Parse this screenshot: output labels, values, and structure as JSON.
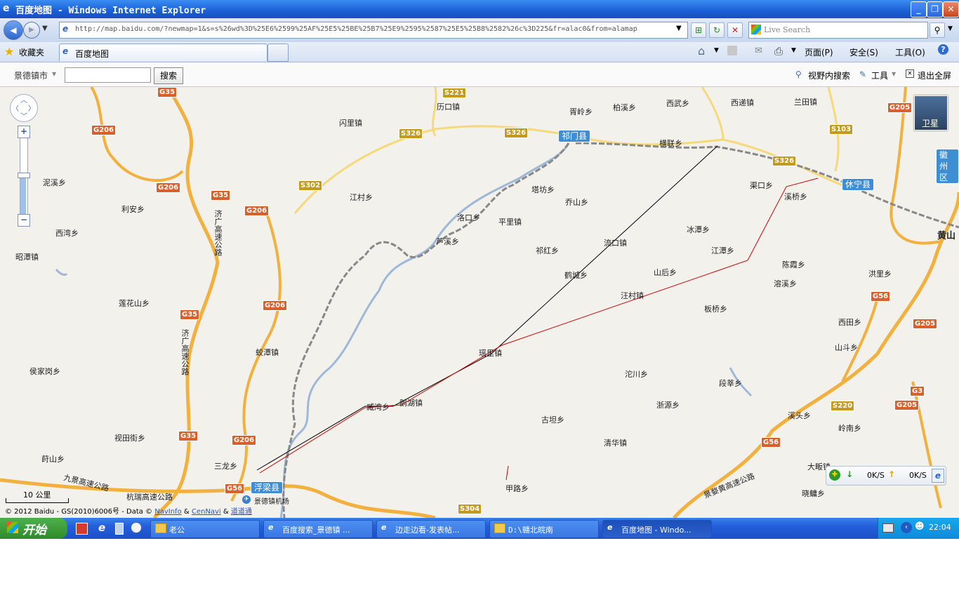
{
  "window": {
    "title": "百度地图 - Windows Internet Explorer",
    "minimize_glyph": "_",
    "restore_glyph": "❐",
    "close_glyph": "✕"
  },
  "address_bar": {
    "url": "http://map.baidu.com/?newmap=1&s=s%26wd%3D%25E6%2599%25AF%25E5%25BE%25B7%25E9%2595%2587%25E5%25B8%2582%26c%3D225&fr=alac0&from=alamap",
    "search_placeholder": "Live Search"
  },
  "favorites": {
    "label": "收藏夹",
    "tab_title": "百度地图"
  },
  "ie_toolbar": {
    "page_label": "页面(P)",
    "safety_label": "安全(S)",
    "tools_label": "工具(O)"
  },
  "baidu_toolbar": {
    "city": "景德镇市",
    "search_button": "搜索",
    "view_search": "视野内搜索",
    "tools": "工具",
    "exit_fullscreen": "退出全屏"
  },
  "map": {
    "satellite_label": "卫星",
    "zoom_in": "+",
    "zoom_out": "−",
    "scale_label": "10 公里",
    "copyright": "© 2012 Baidu - GS(2010)6006号 - Data ©",
    "copyright_links": [
      "NavInfo",
      "CenNavi",
      "道道通"
    ],
    "copyright_amp": "&",
    "counties": [
      {
        "name": "祁门县"
      },
      {
        "name": "休宁县"
      },
      {
        "name": "浮梁县"
      }
    ],
    "towns": [
      "历口镇",
      "闪里镇",
      "胥岭乡",
      "柏溪乡",
      "西武乡",
      "西递镇",
      "兰田镇",
      "横联乡",
      "泥溪乡",
      "利安乡",
      "西湾乡",
      "昭潭镇",
      "江村乡",
      "塔坊乡",
      "乔山乡",
      "洛口乡",
      "平里镇",
      "芦溪乡",
      "祁红乡",
      "流口镇",
      "渠口乡",
      "溪桥乡",
      "冰潭乡",
      "江潭乡",
      "鹤城乡",
      "山后乡",
      "陈霞乡",
      "洪里乡",
      "汪村镇",
      "溶溪乡",
      "莲花山乡",
      "板桥乡",
      "西田乡",
      "侯家岗乡",
      "蛟潭镇",
      "瑶里镇",
      "山斗乡",
      "沱川乡",
      "段莘乡",
      "臧湾乡",
      "鹅湖镇",
      "浙源乡",
      "古坦乡",
      "溪头乡",
      "岭南乡",
      "视田街乡",
      "清华镇",
      "莳山乡",
      "三龙乡",
      "大畈镇",
      "甲路乡",
      "晓鳙乡",
      "景德镇机场",
      "黄山",
      "徽州区"
    ],
    "highways": [
      "G35",
      "G206",
      "S221",
      "S326",
      "S326",
      "S326",
      "G205",
      "S103",
      "S302",
      "G206",
      "G35",
      "G206",
      "G206",
      "G35",
      "G35",
      "G206",
      "G56",
      "S304",
      "G56",
      "G56",
      "G3",
      "S220",
      "G205",
      "G205"
    ],
    "expressways": [
      "济广高速公路",
      "济广高速公路",
      "九景高速公路",
      "杭瑞高速公路",
      "景婺黄高速公路"
    ]
  },
  "speed_widget": {
    "down": "0K/S",
    "up": "0K/S"
  },
  "taskbar": {
    "start": "开始",
    "tasks": [
      {
        "label": "老公"
      },
      {
        "label": "百度搜索_景德镇 ..."
      },
      {
        "label": "边走边看-发表帖..."
      },
      {
        "label": "D:\\赣北皖南"
      },
      {
        "label": "百度地图 - Windo..."
      }
    ],
    "clock": "22:04"
  }
}
